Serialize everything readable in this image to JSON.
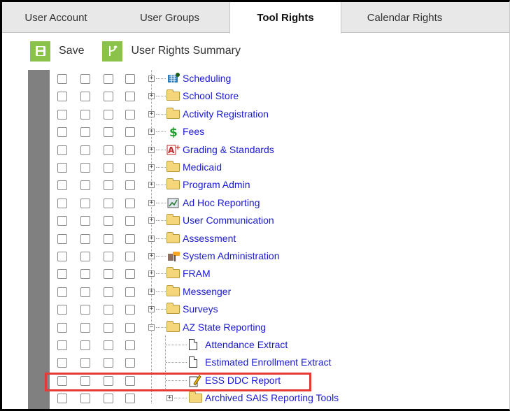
{
  "tabs": [
    {
      "label": "User Account"
    },
    {
      "label": "User Groups"
    },
    {
      "label": "Tool Rights"
    },
    {
      "label": "Calendar Rights"
    }
  ],
  "toolbar": {
    "save_label": "Save",
    "summary_label": "User Rights Summary"
  },
  "tree": [
    {
      "label": "Scheduling",
      "icon": "scheduling-icon"
    },
    {
      "label": "School Store",
      "icon": "folder-icon"
    },
    {
      "label": "Activity Registration",
      "icon": "folder-icon"
    },
    {
      "label": "Fees",
      "icon": "dollar-icon"
    },
    {
      "label": "Grading & Standards",
      "icon": "grading-icon"
    },
    {
      "label": "Medicaid",
      "icon": "folder-icon"
    },
    {
      "label": "Program Admin",
      "icon": "folder-icon"
    },
    {
      "label": "Ad Hoc Reporting",
      "icon": "adhoc-icon"
    },
    {
      "label": "User Communication",
      "icon": "folder-icon"
    },
    {
      "label": "Assessment",
      "icon": "folder-icon"
    },
    {
      "label": "System Administration",
      "icon": "system-admin-icon"
    },
    {
      "label": "FRAM",
      "icon": "folder-icon"
    },
    {
      "label": "Messenger",
      "icon": "folder-icon"
    },
    {
      "label": "Surveys",
      "icon": "folder-icon"
    },
    {
      "label": "AZ State Reporting",
      "icon": "folder-icon"
    },
    {
      "label": "Attendance Extract",
      "icon": "document-icon"
    },
    {
      "label": "Estimated Enrollment Extract",
      "icon": "document-icon"
    },
    {
      "label": "ESS DDC Report",
      "icon": "report-pencil-icon"
    },
    {
      "label": "Archived SAIS Reporting Tools",
      "icon": "folder-icon"
    }
  ],
  "colors": {
    "accent_green": "#8bc34a",
    "link_blue": "#1a1ad2",
    "highlight_red": "#e53935"
  }
}
